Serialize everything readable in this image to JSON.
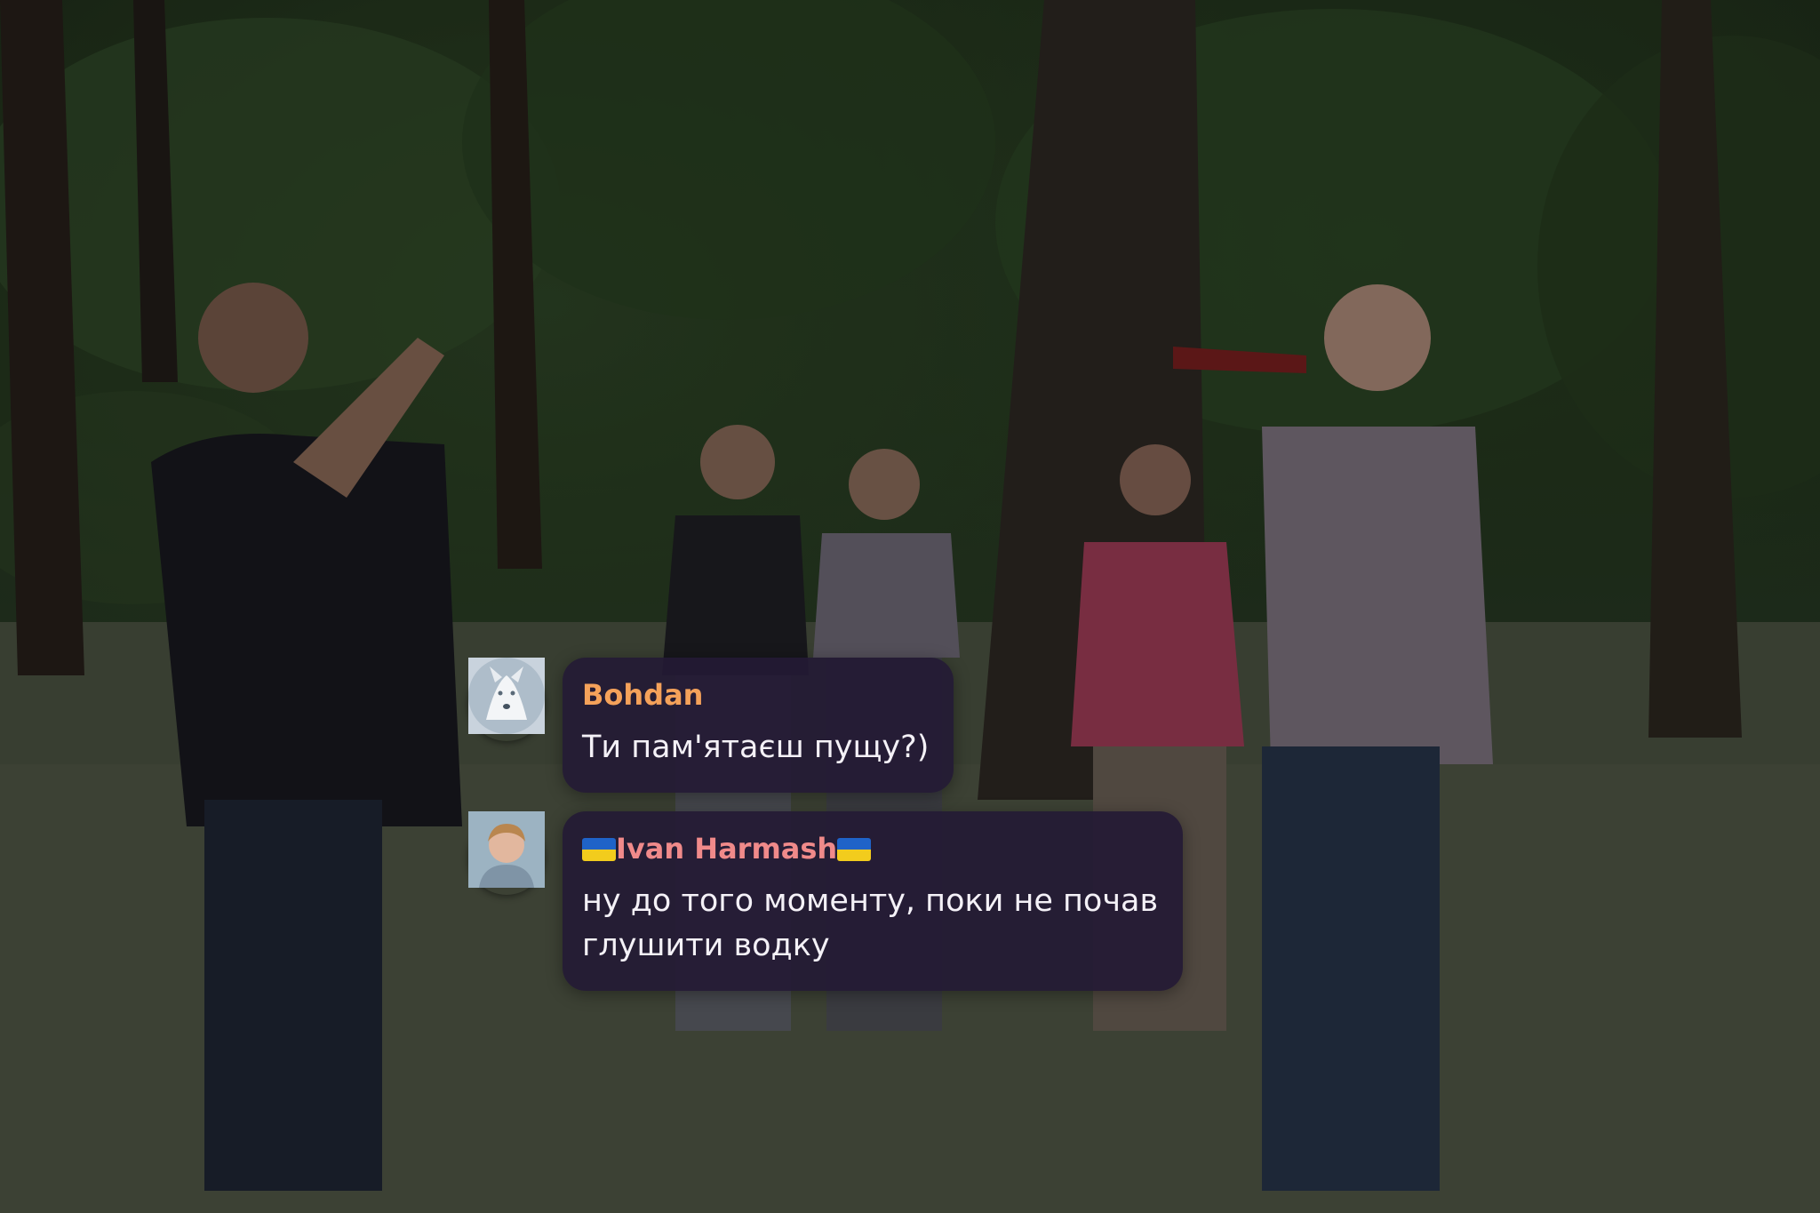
{
  "chat": {
    "messages": [
      {
        "sender": "Bohdan",
        "sender_color": "#f5a25a",
        "avatar": "white-wolf-avatar",
        "text": "Ти пам'ятаєш пущу?)"
      },
      {
        "sender": "Ivan Harmash",
        "sender_color": "#f08a8a",
        "sender_prefix_icon": "ukraine-flag-icon",
        "sender_suffix_icon": "ukraine-flag-icon",
        "avatar": "person-photo-avatar",
        "text_line_1": "ну до того моменту, поки не почав",
        "text_line_2": "глушити водку"
      }
    ]
  },
  "colors": {
    "bubble_background": "#241a34",
    "message_text": "#f4f1f7",
    "flag_blue": "#1f63c8",
    "flag_yellow": "#f2cc1d"
  }
}
